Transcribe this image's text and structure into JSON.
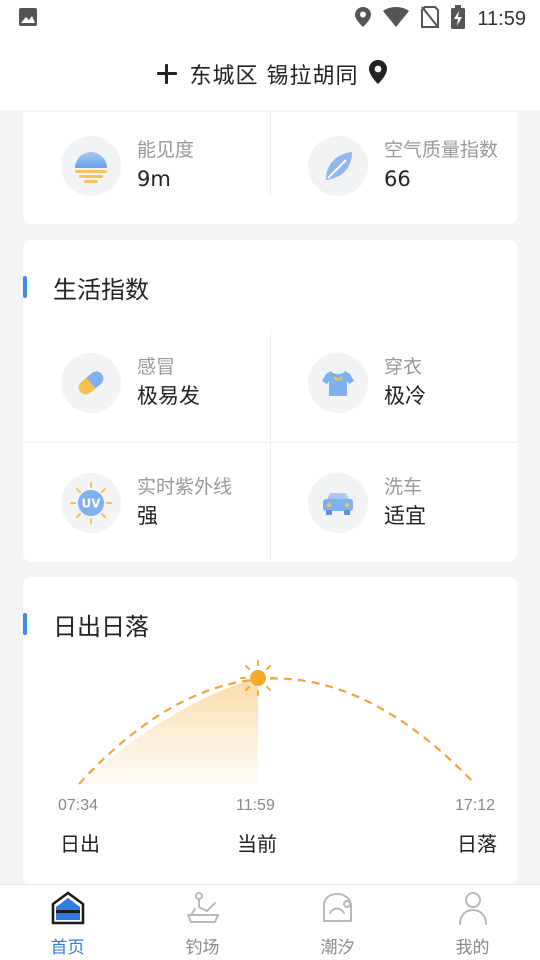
{
  "status_bar": {
    "time": "11:59",
    "icons": [
      "image-icon",
      "location-icon",
      "wifi-icon",
      "no-sim-icon",
      "battery-charging-icon"
    ]
  },
  "header": {
    "title": "东城区 锡拉胡同",
    "add_icon": "plus-icon",
    "location_icon": "location-pin-icon"
  },
  "weather_details": [
    {
      "label": "能见度",
      "value": "9m",
      "icon": "visibility-icon"
    },
    {
      "label": "空气质量指数",
      "value": "66",
      "icon": "leaf-icon"
    }
  ],
  "life_index": {
    "title": "生活指数",
    "items": [
      {
        "label": "感冒",
        "value": "极易发",
        "icon": "pill-icon"
      },
      {
        "label": "穿衣",
        "value": "极冷",
        "icon": "shirt-icon"
      },
      {
        "label": "实时紫外线",
        "value": "强",
        "icon": "uv-icon"
      },
      {
        "label": "洗车",
        "value": "适宜",
        "icon": "car-icon"
      }
    ]
  },
  "sun": {
    "title": "日出日落",
    "sunrise": {
      "time": "07:34",
      "label": "日出"
    },
    "current": {
      "time": "11:59",
      "label": "当前"
    },
    "sunset": {
      "time": "17:12",
      "label": "日落"
    },
    "colors": {
      "arc": "#f0a53c",
      "sun": "#f7a928"
    }
  },
  "bottom_nav": {
    "items": [
      {
        "label": "首页",
        "icon": "home-icon",
        "active": true
      },
      {
        "label": "钓场",
        "icon": "fishing-spot-icon",
        "active": false
      },
      {
        "label": "潮汐",
        "icon": "tide-icon",
        "active": false
      },
      {
        "label": "我的",
        "icon": "profile-icon",
        "active": false
      }
    ],
    "active_color": "#2f7de1"
  }
}
